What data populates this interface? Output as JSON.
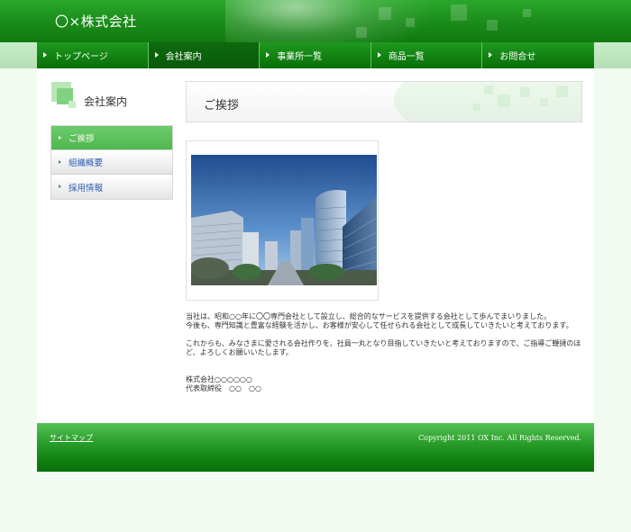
{
  "header": {
    "site_title": "〇×株式会社"
  },
  "nav": {
    "items": [
      {
        "label": "トップページ",
        "active": false
      },
      {
        "label": "会社案内",
        "active": true
      },
      {
        "label": "事業所一覧",
        "active": false
      },
      {
        "label": "商品一覧",
        "active": false
      },
      {
        "label": "お問合せ",
        "active": false
      }
    ]
  },
  "sidebar": {
    "heading": "会社案内",
    "items": [
      {
        "label": "ご挨拶",
        "active": true
      },
      {
        "label": "組織概要",
        "active": false
      },
      {
        "label": "採用情報",
        "active": false
      }
    ]
  },
  "content": {
    "heading": "ご挨拶",
    "paragraph1": "当社は、昭和○○年に〇〇専門会社として設立し、総合的なサービスを提供する会社として歩んでまいりました。\n今後も、専門知識と豊富な経験を活かし、お客様が安心して任せられる会社として成長していきたいと考えております。",
    "paragraph2": "これからも、みなさまに愛される会社作りを、社員一丸となり目指していきたいと考えておりますので、ご指導ご鞭撻のほど、よろしくお願いいたします。",
    "signature_company": "株式会社○○○○○○",
    "signature_name": "代表取締役　○○　○○"
  },
  "footer": {
    "sitemap_label": "サイトマップ",
    "copyright": "Copyright 2011 OX Inc. All Rights Reserved."
  },
  "colors": {
    "brand_green": "#118211",
    "accent_green": "#4fb84f",
    "link_blue": "#2a5db0"
  }
}
